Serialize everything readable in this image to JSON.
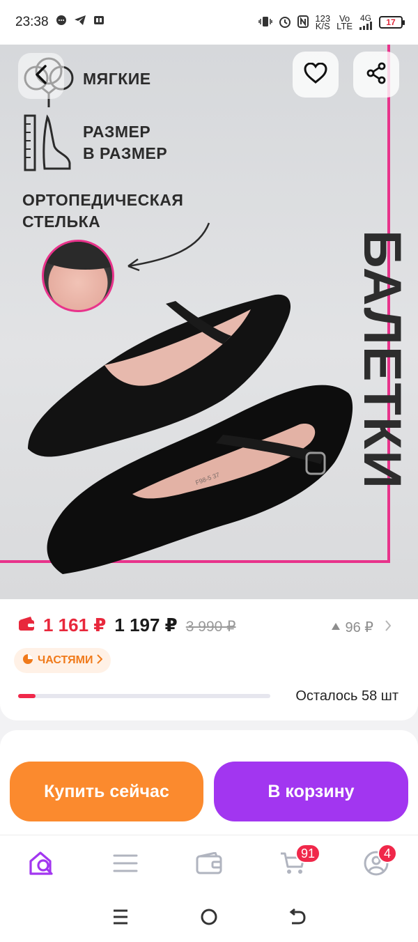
{
  "status_bar": {
    "time": "23:38",
    "net_speed_top": "123",
    "net_speed_bottom": "K/S",
    "volte_top": "Vo",
    "volte_bottom": "LTE",
    "network": "4G",
    "battery": "17"
  },
  "hero": {
    "feature_soft": "МЯГКИЕ",
    "feature_size_line1": "РАЗМЕР",
    "feature_size_line2": "В РАЗМЕР",
    "feature_insole_line1": "ОРТОПЕДИЧЕСКАЯ",
    "feature_insole_line2": "СТЕЛЬКА",
    "vertical_title": "БАЛЕТКИ",
    "shoe_label": "F98-5 37"
  },
  "price": {
    "wallet_price": "1 161 ₽",
    "price": "1 197 ₽",
    "old_price": "3 990 ₽",
    "cashback": "96 ₽",
    "installments_label": "ЧАСТЯМИ",
    "stock_text": "Осталось 58 шт",
    "stock_fraction": 0.07
  },
  "actions": {
    "buy_now": "Купить сейчас",
    "add_to_cart": "В корзину"
  },
  "tabs": {
    "cart_badge": "91",
    "profile_badge": "4"
  },
  "colors": {
    "accent_purple": "#a236f0",
    "accent_orange": "#fb8a2e",
    "price_red": "#e8283c",
    "pink_frame": "#e8338b"
  }
}
